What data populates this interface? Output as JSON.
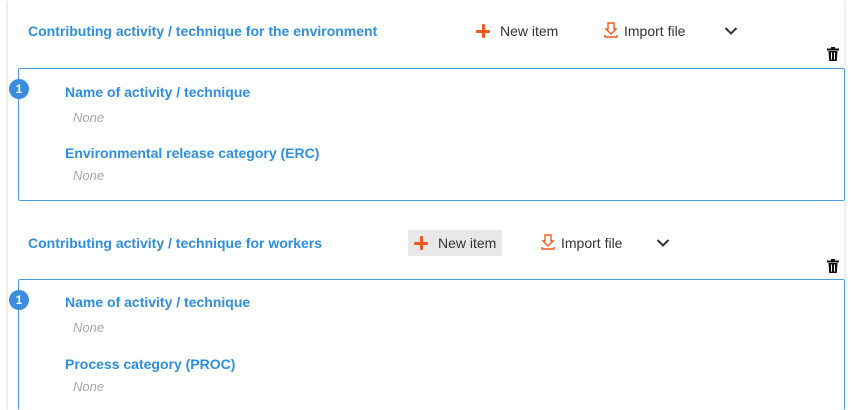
{
  "sections": [
    {
      "title": "Contributing activity / technique for the environment",
      "new_item_label": "New item",
      "import_label": "Import file",
      "item": {
        "badge": "1",
        "fields": [
          {
            "label": "Name of activity / technique",
            "value": "None"
          },
          {
            "label": "Environmental release category (ERC)",
            "value": "None"
          }
        ]
      }
    },
    {
      "title": "Contributing activity / technique for workers",
      "new_item_label": "New item",
      "import_label": "Import file",
      "item": {
        "badge": "1",
        "fields": [
          {
            "label": "Name of activity / technique",
            "value": "None"
          },
          {
            "label": "Process category (PROC)",
            "value": "None"
          }
        ]
      }
    }
  ],
  "colors": {
    "accent": "#2d8fde",
    "plus": "#f05a1e",
    "border": "#4a9ae6",
    "placeholder": "#a7a7a7",
    "badge": "#3b8de0"
  },
  "icons": [
    "plus-icon",
    "import-file-icon",
    "chevron-down-icon",
    "trash-icon"
  ]
}
